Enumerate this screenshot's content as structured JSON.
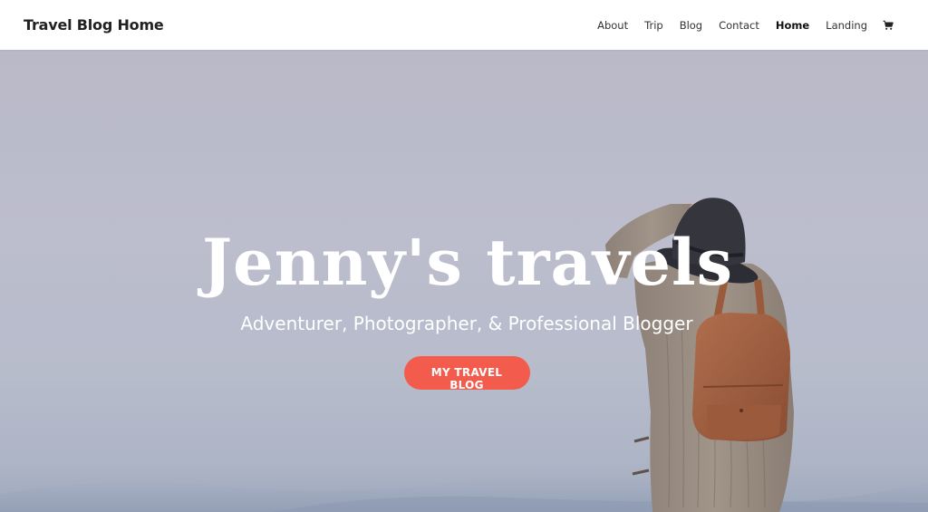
{
  "header": {
    "site_title": "Travel Blog Home",
    "nav": [
      {
        "label": "About"
      },
      {
        "label": "Trip"
      },
      {
        "label": "Blog"
      },
      {
        "label": "Contact"
      },
      {
        "label": "Home",
        "active": true
      },
      {
        "label": "Landing"
      }
    ],
    "cart_icon": "shopping-cart-icon"
  },
  "hero": {
    "title": "Jenny's travels",
    "subtitle": "Adventurer, Photographer, & Professional Blogger",
    "cta_label": "MY TRAVEL BLOG",
    "cta_color": "#f35c4d"
  }
}
